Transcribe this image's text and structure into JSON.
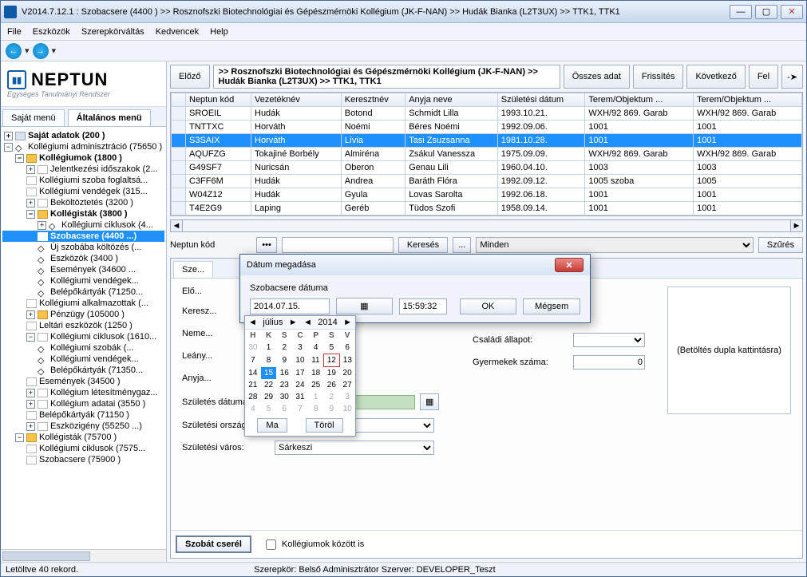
{
  "window": {
    "title": "V2014.7.12.1 : Szobacsere (4400 )  >> Rosznofszki Biotechnológiai és Gépészmérnöki Kollégium (JK-F-NAN) >> Hudák Bianka (L2T3UX) >> TTK1, TTK1",
    "min": "—",
    "max": "▢",
    "close": "✕"
  },
  "menu": [
    "File",
    "Eszközök",
    "Szerepkörváltás",
    "Kedvencek",
    "Help"
  ],
  "logo": {
    "big": "NEPTUN",
    "sub": "Egységes Tanulmányi Rendszer"
  },
  "left_tabs": {
    "a": "Saját menü",
    "b": "Általános menü"
  },
  "tree": {
    "root": "Saját adatok (200  )",
    "koll_admin": "Kollégiumi adminisztráció (75650 )",
    "kollegiumok": "Kollégiumok (1800  )",
    "jelentk": "Jelentkezési időszakok (2...",
    "szobafog": "Kollégiumi szoba foglaltsá...",
    "vendeg31": "Kollégiumi vendégek (315...",
    "bekolt": "Beköltöztetés (3200  )",
    "kollegistak": "Kollégisták (3800  )",
    "ciklusok4": "Kollégiumi ciklusok (4...",
    "szobacsere": "Szobacsere (4400 ...)",
    "ujszoba": "Új szobába költözés (...",
    "eszkozok34": "Eszközök (3400  )",
    "esemenyek34": "Események (34600 ...",
    "koll_vendeg": "Kollégiumi vendégek...",
    "belepo712": "Belépőkártyák (71250...",
    "alkalm": "Kollégiumi alkalmazottak (...",
    "penzugy": "Pénzügy (105000  )",
    "leltari": "Leltári eszközök (1250  )",
    "ciklusok16": "Kollégiumi ciklusok (1610...",
    "szobak": "Kollégiumi szobák (...",
    "koll_vendeg2": "Kollégiumi vendégek...",
    "belepo713": "Belépőkártyák (71350...",
    "esemenyek345": "Események (34500 )",
    "letesitmeny": "Kollégium létesítménygaz...",
    "adatai": "Kollégium adatai (3550  )",
    "belepo711": "Belépőkártyák (71150  )",
    "eszkozig": "Eszközigény (55250  ...)",
    "kollegistak757": "Kollégisták (75700  )",
    "ciklusok757": "Kollégiumi ciklusok (7575...",
    "szobacsere759": "Szobacsere (75900  )"
  },
  "top_buttons": {
    "prev": "Előző",
    "all": "Összes adat",
    "refresh": "Frissítés",
    "next": "Következő",
    "up": "Fel",
    "pin": "-➤"
  },
  "crumb": ">> Rosznofszki Biotechnológiai és Gépészmérnöki Kollégium (JK-F-NAN) >> Hudák Bianka (L2T3UX) >> TTK1, TTK1",
  "grid": {
    "cols": [
      "Neptun kód",
      "Vezetéknév",
      "Keresztnév",
      "Anyja neve",
      "Születési dátum",
      "Terem/Objektum ...",
      "Terem/Objektum ..."
    ],
    "rows": [
      [
        "SROEIL",
        "Hudák",
        "Botond",
        "Schmidt Lilla",
        "1993.10.21.",
        "WXH/92 869. Garab",
        "WXH/92 869. Garab"
      ],
      [
        "TNTTXC",
        "Horváth",
        "Noémi",
        "Béres Noémi",
        "1992.09.06.",
        "1001",
        "1001"
      ],
      [
        "S3SAIX",
        "Horváth",
        "Lívia",
        "Tasi Zsuzsanna",
        "1981.10.28.",
        "1001",
        "1001"
      ],
      [
        "AQUFZG",
        "Tokajiné Borbély",
        "Almiréna",
        "Zsákul Vanessza",
        "1975.09.09.",
        "WXH/92 869. Garab",
        "WXH/92 869. Garab"
      ],
      [
        "G49SF7",
        "Nuricsán",
        "Oberon",
        "Genau Lili",
        "1960.04.10.",
        "1003",
        "1003"
      ],
      [
        "C3FF6M",
        "Hudák",
        "Andrea",
        "Baráth Flóra",
        "1992.09.12.",
        "1005 szoba",
        "1005"
      ],
      [
        "W04Z12",
        "Hudák",
        "Gyula",
        "Lovas Sarolta",
        "1992.06.18.",
        "1001",
        "1001"
      ],
      [
        "T4E2G9",
        "Laping",
        "Geréb",
        "Tüdos Szofi",
        "1958.09.14.",
        "1001",
        "1001"
      ]
    ],
    "selected": 2
  },
  "search": {
    "label": "Neptun kód",
    "btn": "Keresés",
    "dots": "...",
    "all": "Minden",
    "filter": "Szűrés"
  },
  "detail": {
    "tab": "Sze...",
    "prev": "Elő...",
    "firstname_lbl": "Keresz...",
    "gender_lbl": "Neme...",
    "maiden_lbl": "Leány...",
    "mother_lbl": "Anyja...",
    "birthdate_lbl": "Születés dátuma:",
    "birthcountry_lbl": "Születési ország:",
    "birthcity_lbl": "Születési város:",
    "marital_lbl": "Családi állapot:",
    "children_lbl": "Gyermekek száma:",
    "children_val": "0",
    "birthdate_val": "1981.10.28.",
    "birthcountry_val": "Magyarország",
    "birthcity_val": "Sárkeszi",
    "photo": "(Betöltés dupla kattintásra)"
  },
  "footer": {
    "swap": "Szobát cserél",
    "between": "Kollégiumok között is"
  },
  "status": {
    "left": "Letöltve 40 rekord.",
    "mid": "Szerepkör: Belső Adminisztrátor   Szerver: DEVELOPER_Teszt"
  },
  "modal": {
    "title": "Dátum megadása",
    "label": "Szobacsere dátuma",
    "date": "2014.07.15.",
    "time": "15:59:32",
    "ok": "OK",
    "cancel": "Mégsem"
  },
  "calendar": {
    "month": "július",
    "year": "2014",
    "dows": [
      "H",
      "K",
      "S",
      "C",
      "P",
      "S",
      "V"
    ],
    "weeks": [
      [
        {
          "d": "30",
          "o": 1
        },
        {
          "d": "1"
        },
        {
          "d": "2"
        },
        {
          "d": "3"
        },
        {
          "d": "4"
        },
        {
          "d": "5"
        },
        {
          "d": "6"
        }
      ],
      [
        {
          "d": "7"
        },
        {
          "d": "8"
        },
        {
          "d": "9"
        },
        {
          "d": "10"
        },
        {
          "d": "11"
        },
        {
          "d": "12",
          "t": 1
        },
        {
          "d": "13"
        }
      ],
      [
        {
          "d": "14"
        },
        {
          "d": "15",
          "s": 1
        },
        {
          "d": "16"
        },
        {
          "d": "17"
        },
        {
          "d": "18"
        },
        {
          "d": "19"
        },
        {
          "d": "20"
        }
      ],
      [
        {
          "d": "21"
        },
        {
          "d": "22"
        },
        {
          "d": "23"
        },
        {
          "d": "24"
        },
        {
          "d": "25"
        },
        {
          "d": "26"
        },
        {
          "d": "27"
        }
      ],
      [
        {
          "d": "28"
        },
        {
          "d": "29"
        },
        {
          "d": "30"
        },
        {
          "d": "31"
        },
        {
          "d": "1",
          "o": 1
        },
        {
          "d": "2",
          "o": 1
        },
        {
          "d": "3",
          "o": 1
        }
      ],
      [
        {
          "d": "4",
          "o": 1
        },
        {
          "d": "5",
          "o": 1
        },
        {
          "d": "6",
          "o": 1
        },
        {
          "d": "7",
          "o": 1
        },
        {
          "d": "8",
          "o": 1
        },
        {
          "d": "9",
          "o": 1
        },
        {
          "d": "10",
          "o": 1
        }
      ]
    ],
    "today": "Ma",
    "clear": "Töröl"
  }
}
